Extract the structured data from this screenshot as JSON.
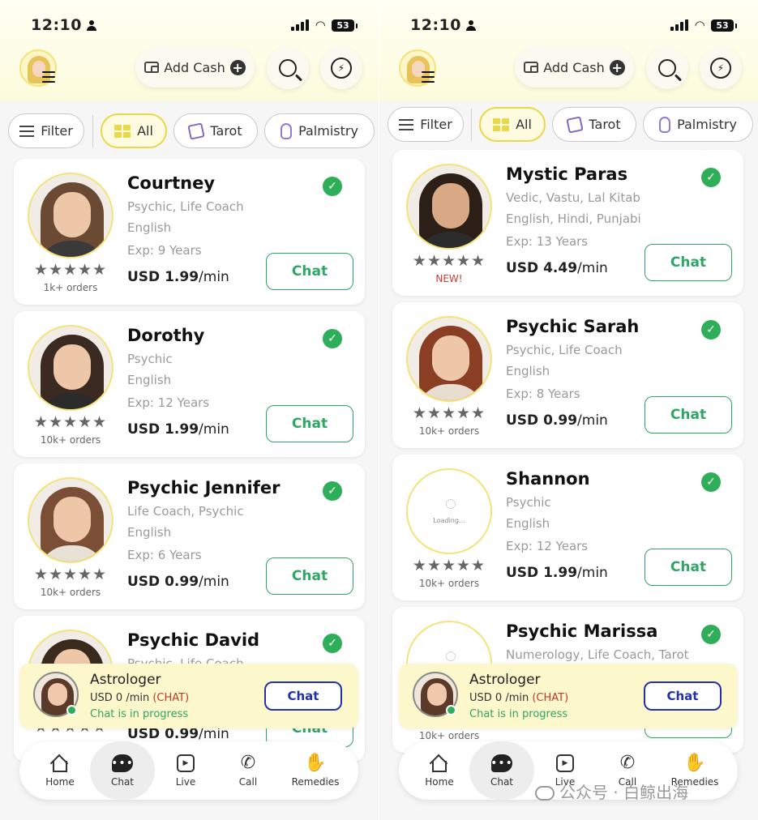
{
  "status_bar": {
    "time": "12:10",
    "battery": "53"
  },
  "header": {
    "add_cash_label": "Add Cash",
    "plus_glyph": "+",
    "messenger_glyph": "⚡"
  },
  "filters": [
    {
      "label": "Filter",
      "icon": "filter-icon"
    },
    {
      "label": "All",
      "icon": "grid-icon",
      "active": true
    },
    {
      "label": "Tarot",
      "icon": "tarot-card-icon"
    },
    {
      "label": "Palmistry",
      "icon": "palm-icon"
    }
  ],
  "chat_button_label": "Chat",
  "stars": "★★★★★",
  "verified_glyph": "✓",
  "left_experts": [
    {
      "name": "Courtney",
      "skills": "Psychic,  Life Coach",
      "languages": "English",
      "experience": "Exp: 9 Years",
      "price": "USD 1.99",
      "per": "/min",
      "orders": "1k+ orders"
    },
    {
      "name": "Dorothy",
      "skills": "Psychic",
      "languages": "English",
      "experience": "Exp: 12 Years",
      "price": "USD 1.99",
      "per": "/min",
      "orders": "10k+ orders"
    },
    {
      "name": "Psychic Jennifer",
      "skills": "Life Coach,  Psychic",
      "languages": "English",
      "experience": "Exp: 6 Years",
      "price": "USD 0.99",
      "per": "/min",
      "orders": "10k+ orders"
    },
    {
      "name": "Psychic David",
      "skills": "Psychic,  Life Coach",
      "languages": "",
      "experience": "",
      "price": "USD 0.99",
      "per": "/min",
      "orders": ""
    }
  ],
  "right_experts": [
    {
      "name": "Mystic Paras",
      "skills": "Vedic,  Vastu,  Lal Kitab",
      "languages": "English, Hindi, Punjabi",
      "experience": "Exp: 13 Years",
      "price": "USD 4.49",
      "per": "/min",
      "orders": "",
      "tag": "NEW!"
    },
    {
      "name": "Psychic Sarah",
      "skills": "Psychic,  Life Coach",
      "languages": "English",
      "experience": "Exp: 8 Years",
      "price": "USD 0.99",
      "per": "/min",
      "orders": "10k+ orders"
    },
    {
      "name": "Shannon",
      "skills": "Psychic",
      "languages": "English",
      "experience": "Exp: 12 Years",
      "price": "USD 1.99",
      "per": "/min",
      "orders": "10k+ orders",
      "photo_loading": "Loading..."
    },
    {
      "name": "Psychic Marissa",
      "skills": "Numerology,  Life Coach,  Tarot",
      "languages": "",
      "experience": "",
      "price": "",
      "per": "",
      "orders": "10k+ orders"
    }
  ],
  "chat_progress": {
    "title": "Astrologer",
    "rate": "USD 0 /min",
    "rate_tag": "(CHAT)",
    "status": "Chat is in progress",
    "button": "Chat"
  },
  "bottom_nav": [
    {
      "label": "Home",
      "icon": "home-icon"
    },
    {
      "label": "Chat",
      "icon": "chat-icon",
      "active": true
    },
    {
      "label": "Live",
      "icon": "live-icon"
    },
    {
      "label": "Call",
      "icon": "call-icon"
    },
    {
      "label": "Remedies",
      "icon": "remedies-icon"
    }
  ],
  "watermark": "公众号 · 白鲸出海",
  "colors": {
    "accent_green": "#2fa566",
    "verified_green": "#2fae5a",
    "highlight_yellow": "#e8d84a",
    "navy": "#2331a6"
  }
}
